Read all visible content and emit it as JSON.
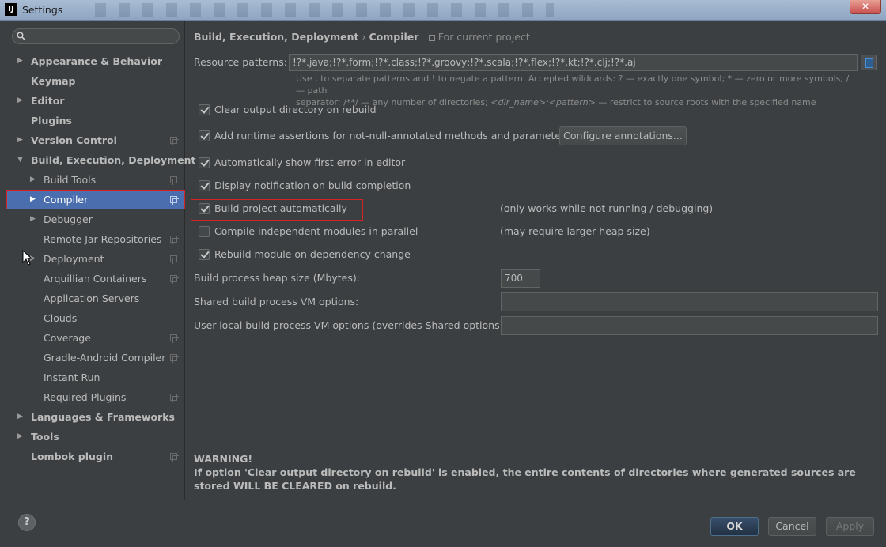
{
  "window": {
    "title": "Settings",
    "app_icon": "IJ",
    "close_glyph": "✕"
  },
  "search": {
    "placeholder": "",
    "value": ""
  },
  "tree": [
    {
      "label": "Appearance & Behavior",
      "level": 0,
      "arrow": true,
      "project": false,
      "selected": false
    },
    {
      "label": "Keymap",
      "level": 0,
      "arrow": false,
      "project": false,
      "selected": false
    },
    {
      "label": "Editor",
      "level": 0,
      "arrow": true,
      "project": false,
      "selected": false
    },
    {
      "label": "Plugins",
      "level": 0,
      "arrow": false,
      "project": false,
      "selected": false
    },
    {
      "label": "Version Control",
      "level": 0,
      "arrow": true,
      "project": true,
      "selected": false
    },
    {
      "label": "Build, Execution, Deployment",
      "level": 0,
      "arrow": true,
      "expanded": true,
      "project": false,
      "selected": false
    },
    {
      "label": "Build Tools",
      "level": 1,
      "arrow": true,
      "project": true,
      "selected": false
    },
    {
      "label": "Compiler",
      "level": 1,
      "arrow": true,
      "project": true,
      "selected": true
    },
    {
      "label": "Debugger",
      "level": 1,
      "arrow": true,
      "project": false,
      "selected": false
    },
    {
      "label": "Remote Jar Repositories",
      "level": 1,
      "arrow": false,
      "project": true,
      "selected": false
    },
    {
      "label": "Deployment",
      "level": 1,
      "arrow": true,
      "project": true,
      "selected": false
    },
    {
      "label": "Arquillian Containers",
      "level": 1,
      "arrow": false,
      "project": true,
      "selected": false
    },
    {
      "label": "Application Servers",
      "level": 1,
      "arrow": false,
      "project": false,
      "selected": false
    },
    {
      "label": "Clouds",
      "level": 1,
      "arrow": false,
      "project": false,
      "selected": false
    },
    {
      "label": "Coverage",
      "level": 1,
      "arrow": false,
      "project": true,
      "selected": false
    },
    {
      "label": "Gradle-Android Compiler",
      "level": 1,
      "arrow": false,
      "project": true,
      "selected": false
    },
    {
      "label": "Instant Run",
      "level": 1,
      "arrow": false,
      "project": false,
      "selected": false
    },
    {
      "label": "Required Plugins",
      "level": 1,
      "arrow": false,
      "project": true,
      "selected": false
    },
    {
      "label": "Languages & Frameworks",
      "level": 0,
      "arrow": true,
      "project": false,
      "selected": false
    },
    {
      "label": "Tools",
      "level": 0,
      "arrow": true,
      "project": false,
      "selected": false
    },
    {
      "label": "Lombok plugin",
      "level": 0,
      "arrow": false,
      "project": true,
      "selected": false
    }
  ],
  "breadcrumb": {
    "parent": "Build, Execution, Deployment",
    "separator": "›",
    "current": "Compiler",
    "scope": "For current project"
  },
  "resource_patterns": {
    "label": "Resource patterns:",
    "value": "!?*.java;!?*.form;!?*.class;!?*.groovy;!?*.scala;!?*.flex;!?*.kt;!?*.clj;!?*.aj",
    "hint_line1": "Use ; to separate patterns and ! to negate a pattern. Accepted wildcards: ? — exactly one symbol; * — zero or more symbols; / — path",
    "hint_line2_a": "separator; /**/ — any number of directories;",
    "hint_line2_italic": "<dir_name>:<pattern>",
    "hint_line2_b": "— restrict to source roots with the specified name"
  },
  "options": {
    "clear_output": {
      "label": "Clear output directory on rebuild",
      "checked": true
    },
    "runtime_assertions": {
      "label": "Add runtime assertions for not-null-annotated methods and parameters",
      "checked": true
    },
    "configure_annotations": "Configure annotations...",
    "show_first_error": {
      "label": "Automatically show first error in editor",
      "checked": true
    },
    "display_notification": {
      "label": "Display notification on build completion",
      "checked": true
    },
    "build_automatically": {
      "label": "Build project automatically",
      "checked": true,
      "note": "(only works while not running / debugging)"
    },
    "compile_parallel": {
      "label": "Compile independent modules in parallel",
      "checked": false,
      "note": "(may require larger heap size)"
    },
    "rebuild_on_dependency": {
      "label": "Rebuild module on dependency change",
      "checked": true
    }
  },
  "heap": {
    "label": "Build process heap size (Mbytes):",
    "value": "700"
  },
  "shared_vm": {
    "label": "Shared build process VM options:",
    "value": ""
  },
  "local_vm": {
    "label": "User-local build process VM options (overrides Shared options):",
    "value": ""
  },
  "warning": {
    "title": "WARNING!",
    "text": "If option 'Clear output directory on rebuild' is enabled, the entire contents of directories where generated sources are stored WILL BE CLEARED on rebuild."
  },
  "footer": {
    "help": "?",
    "ok": "OK",
    "cancel": "Cancel",
    "apply": "Apply"
  }
}
